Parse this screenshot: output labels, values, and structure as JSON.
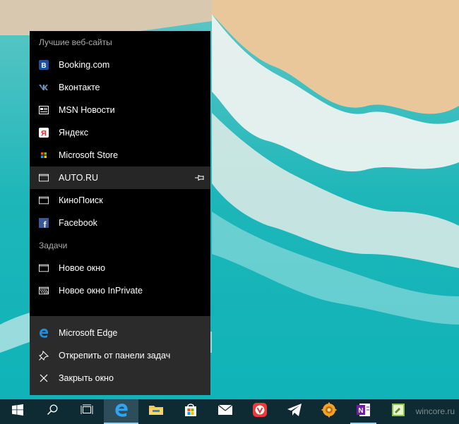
{
  "jumplist": {
    "sections": {
      "top_sites": "Лучшие веб-сайты",
      "tasks": "Задачи"
    },
    "top_sites": [
      {
        "label": "Booking.com",
        "icon": "booking-icon"
      },
      {
        "label": "Вконтакте",
        "icon": "vk-icon"
      },
      {
        "label": "MSN Новости",
        "icon": "news-icon"
      },
      {
        "label": "Яндекс",
        "icon": "yandex-icon"
      },
      {
        "label": "Microsoft Store",
        "icon": "windows-logo-icon"
      },
      {
        "label": "AUTO.RU",
        "icon": "page-icon",
        "hovered": true
      },
      {
        "label": "КиноПоиск",
        "icon": "page-icon"
      },
      {
        "label": "Facebook",
        "icon": "facebook-icon"
      }
    ],
    "tasks": [
      {
        "label": "Новое окно",
        "icon": "window-icon"
      },
      {
        "label": "Новое окно InPrivate",
        "icon": "inprivate-window-icon"
      }
    ],
    "app_actions": [
      {
        "label": "Microsoft Edge",
        "icon": "edge-icon"
      },
      {
        "label": "Открепить от панели задач",
        "icon": "unpin-icon"
      },
      {
        "label": "Закрыть окно",
        "icon": "close-icon"
      }
    ]
  },
  "taskbar": {
    "buttons": [
      {
        "name": "start",
        "icon": "windows-start-icon"
      },
      {
        "name": "search",
        "icon": "search-icon"
      },
      {
        "name": "task-view",
        "icon": "task-view-icon"
      },
      {
        "name": "edge",
        "icon": "edge-icon",
        "active": true
      },
      {
        "name": "file-explorer",
        "icon": "folder-icon"
      },
      {
        "name": "store",
        "icon": "store-bag-icon"
      },
      {
        "name": "mail",
        "icon": "mail-icon"
      },
      {
        "name": "vivaldi",
        "icon": "vivaldi-icon"
      },
      {
        "name": "telegram",
        "icon": "telegram-icon"
      },
      {
        "name": "settings-app",
        "icon": "gear-app-icon"
      },
      {
        "name": "onenote",
        "icon": "onenote-icon"
      },
      {
        "name": "notepad",
        "icon": "notepad-icon"
      }
    ],
    "watermark": "wincore.ru"
  },
  "colors": {
    "accent": "#0a6fd1",
    "menu_bg": "#000000",
    "menu_bottom_bg": "#2b2b2b",
    "taskbar_bg": "#0e2a33"
  }
}
